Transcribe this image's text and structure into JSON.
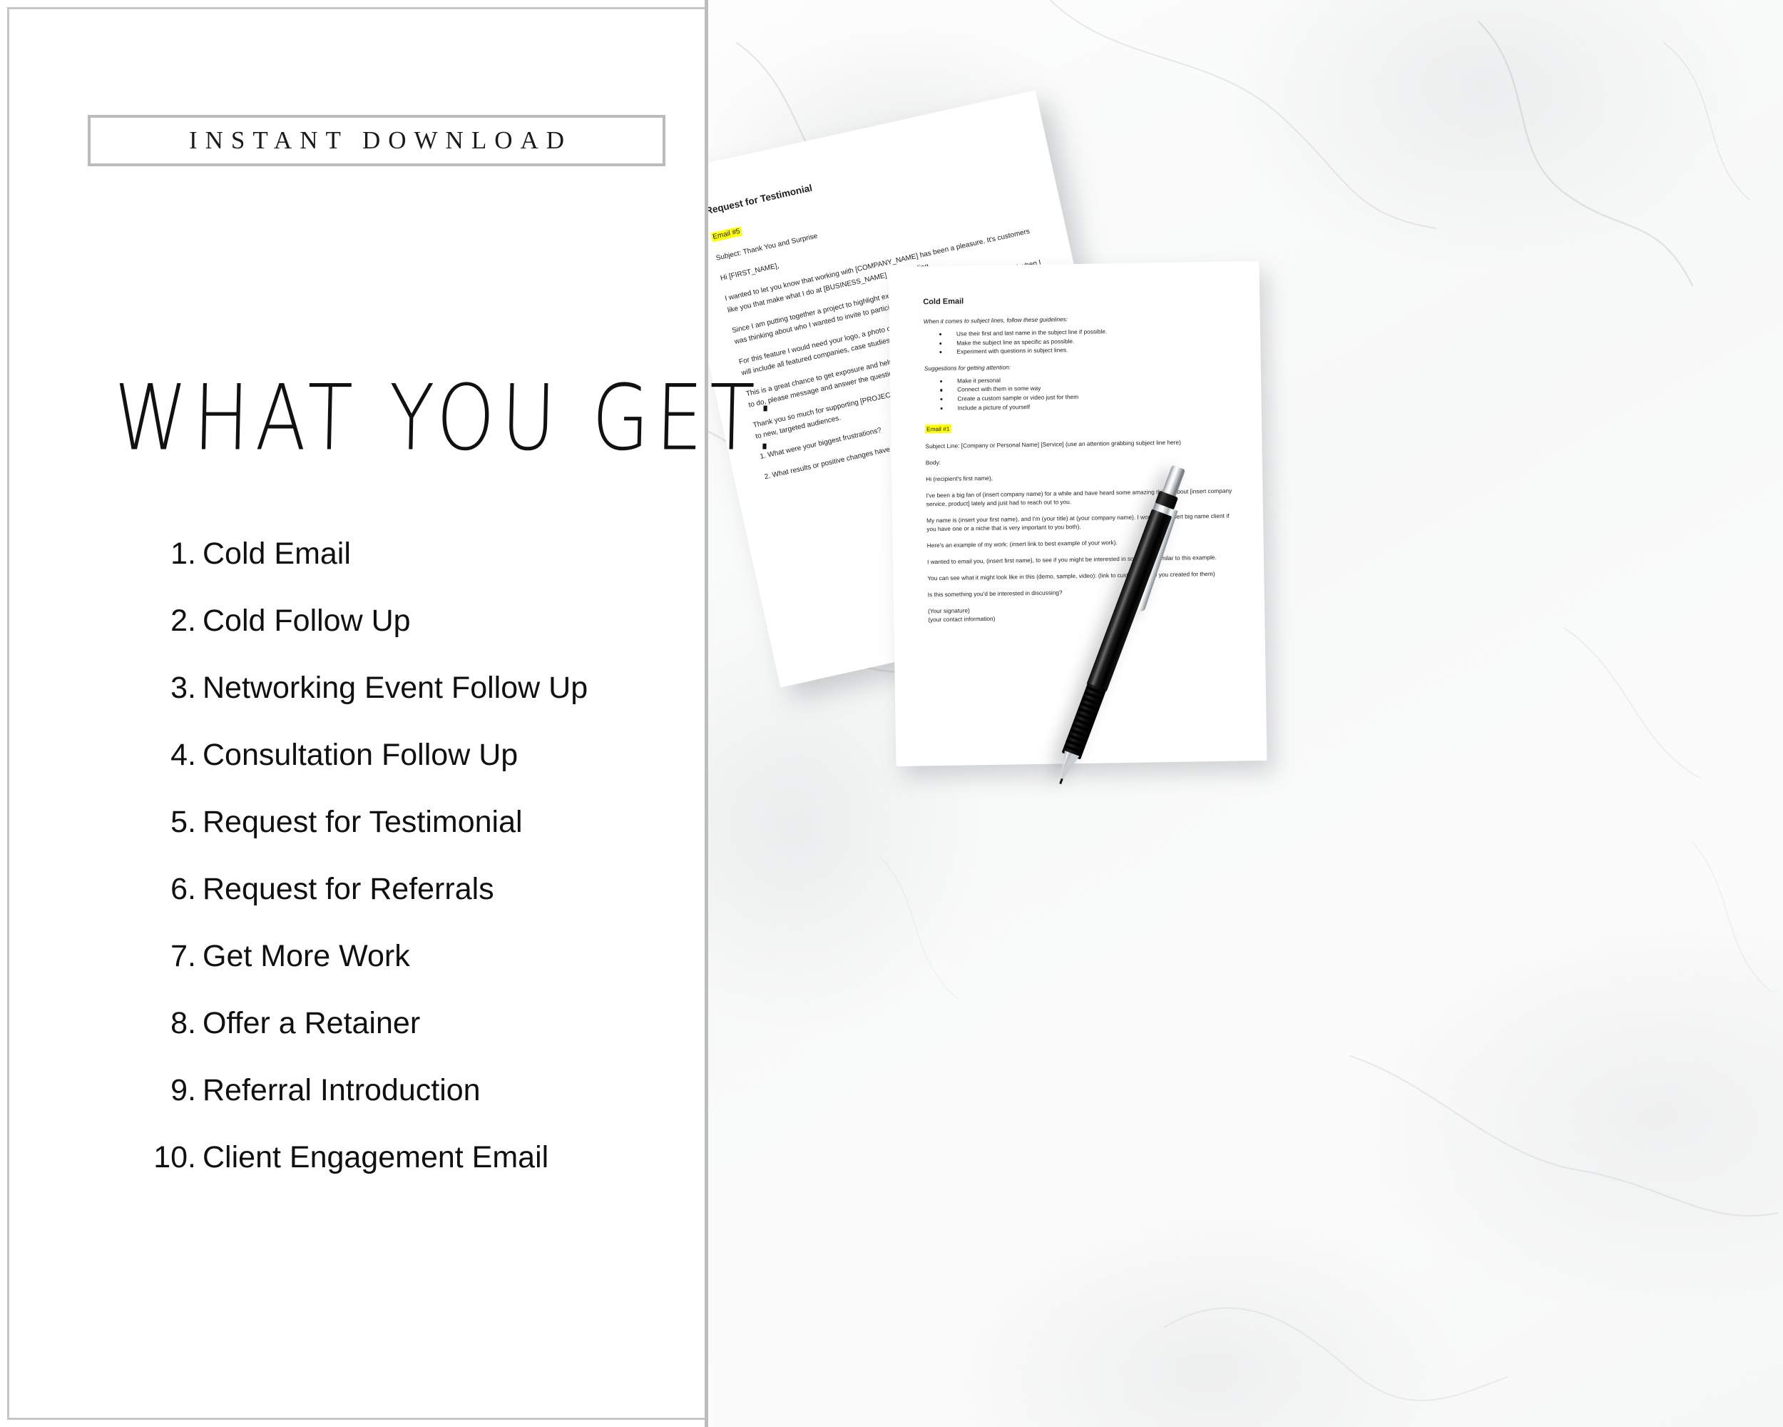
{
  "left_panel": {
    "badge": "INSTANT DOWNLOAD",
    "heading": "WHAT YOU GET:",
    "items": [
      {
        "num": "1.",
        "label": "Cold Email"
      },
      {
        "num": "2.",
        "label": "Cold Follow Up"
      },
      {
        "num": "3.",
        "label": "Networking Event Follow Up"
      },
      {
        "num": "4.",
        "label": "Consultation Follow Up"
      },
      {
        "num": "5.",
        "label": "Request for Testimonial"
      },
      {
        "num": "6.",
        "label": "Request for Referrals"
      },
      {
        "num": "7.",
        "label": "Get More Work"
      },
      {
        "num": "8.",
        "label": "Offer a Retainer"
      },
      {
        "num": "9.",
        "label": "Referral Introduction"
      },
      {
        "num": "10.",
        "label": "Client Engagement Email"
      }
    ]
  },
  "documents": {
    "back": {
      "title": "Request for Testimonial",
      "email_tag": "Email #5",
      "subject": "Subject: Thank You and Surprise",
      "greeting": "Hi [FIRST_NAME],",
      "paragraphs": [
        "I wanted to let you know that working with [COMPANY_NAME] has been a pleasure. It's customers like you that make what I do at [BUSINESS_NAME] so rewarding.",
        "Since I am putting together a project to highlight exceptional businesses I've worked with and when I was thinking about who I wanted to invite to participate, your name came to mind right away.",
        "For this feature I would need your logo, a photo of you, a short description of your business. The page will include all featured companies, case studies, and testimonials.",
        "This is a great chance to get exposure and help promote your business. If this is something you'd like to do, please message and answer the questions below, in as much detail as you can.",
        "Thank you so much for supporting [PROJECT_NAME] and I look forward to introducing your business to new, targeted audiences.",
        "1. What were your biggest frustrations?",
        "2. What results or positive changes have you seen?"
      ]
    },
    "front": {
      "title": "Cold Email",
      "intro_italic": "When it comes to subject lines, follow these guidelines:",
      "guidelines": [
        "Use their first and last name in the subject line if possible.",
        "Make the subject line as specific as possible.",
        "Experiment with questions in subject lines."
      ],
      "suggestions_italic": "Suggestions for getting attention:",
      "suggestions": [
        "Make it personal",
        "Connect with them in some way",
        "Create a custom sample or video just for them",
        "Include a picture of yourself"
      ],
      "email_tag": "Email #1",
      "subject_line": "Subject Line:  [Company or Personal Name] [Service] (use an attention grabbing subject line here)",
      "body_label": "Body:",
      "greeting": "Hi (recipient's first name),",
      "paragraphs": [
        "I've been a big fan of (insert company name) for a while and have heard some amazing things about [insert company service, product] lately and just had to reach out to you.",
        "My name is (insert your first name), and I'm (your title) at (your company name). I work with (insert big name client if you have one or a niche that is very important to you both).",
        "Here's an example of my work: (insert link to best example of your work).",
        "I wanted to email you, (insert first name), to see if you might be interested in something similar to this example.",
        "You can see what it might look like in this (demo, sample, video): (link to custom sample you created for them)",
        "Is this something you'd be interested in discussing?"
      ],
      "signature_line_1": "(Your signature)",
      "signature_line_2": "(your contact information)"
    }
  },
  "colors": {
    "highlight": "#ffff00",
    "panel_border": "#c6c6c6",
    "text": "#101010",
    "marble_vein": "#9aa0a4"
  }
}
